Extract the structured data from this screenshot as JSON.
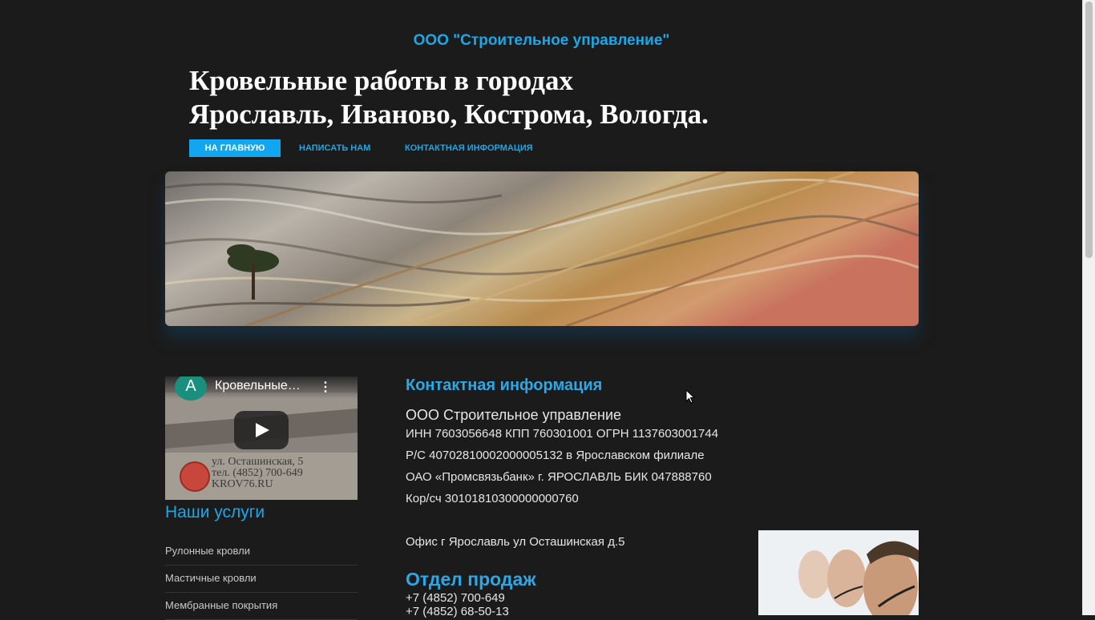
{
  "header": {
    "company": "ООО \"Строительное управление\"",
    "headline_line1": "Кровельные работы в городах",
    "headline_line2": "Ярославль, Иваново, Кострома, Вологда."
  },
  "nav": {
    "items": [
      {
        "label": "НА ГЛАВНУЮ"
      },
      {
        "label": "НАПИСАТЬ НАМ"
      },
      {
        "label": "КОНТАКТНАЯ ИНФОРМАЦИЯ"
      }
    ]
  },
  "video": {
    "channel_letter": "A",
    "title": "Кровельные…",
    "caption_line1": "ул. Осташинская, 5",
    "caption_line2": "тел. (4852) 700-649",
    "caption_line3": "KROV76.RU"
  },
  "sidebar": {
    "title": "Наши услуги",
    "services": [
      {
        "label": "Рулонные кровли"
      },
      {
        "label": "Мастичные кровли"
      },
      {
        "label": "Мембранные покрытия"
      }
    ]
  },
  "contact": {
    "title": "Контактная информация",
    "org_name": "ООО Строительное управление",
    "requisites": [
      "ИНН 7603056648 КПП 760301001 ОГРН 1137603001744",
      "Р/С 40702810002000005132 в Ярославском филиале",
      "ОАО «Промсвязьбанк» г. ЯРОСЛАВЛЬ БИК 047888760",
      "Кор/сч 30101810300000000760"
    ],
    "office": "Офис г Ярославль ул Осташинская д.5",
    "sales_title": "Отдел продаж",
    "phones": [
      "+7 (4852) 700-649",
      "+7 (4852) 68-50-13"
    ]
  },
  "colors": {
    "background": "#1b1b1b",
    "accent": "#1ba7e8",
    "nav_active": "#12a6f0"
  }
}
